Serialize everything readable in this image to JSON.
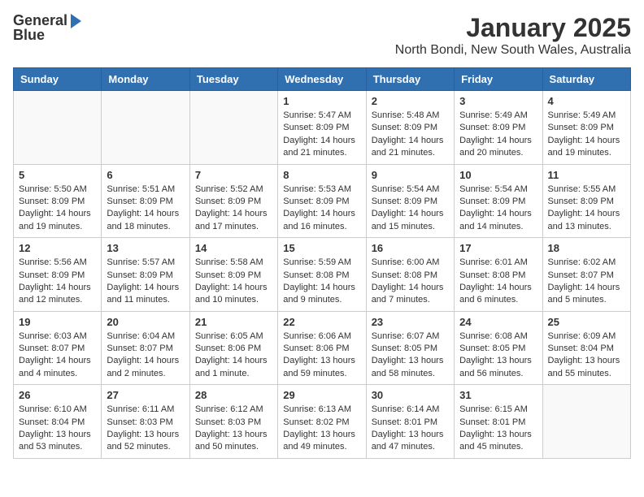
{
  "logo": {
    "line1": "General",
    "line2": "Blue"
  },
  "title": "January 2025",
  "subtitle": "North Bondi, New South Wales, Australia",
  "days_of_week": [
    "Sunday",
    "Monday",
    "Tuesday",
    "Wednesday",
    "Thursday",
    "Friday",
    "Saturday"
  ],
  "weeks": [
    [
      {
        "day": "",
        "info": ""
      },
      {
        "day": "",
        "info": ""
      },
      {
        "day": "",
        "info": ""
      },
      {
        "day": "1",
        "info": "Sunrise: 5:47 AM\nSunset: 8:09 PM\nDaylight: 14 hours\nand 21 minutes."
      },
      {
        "day": "2",
        "info": "Sunrise: 5:48 AM\nSunset: 8:09 PM\nDaylight: 14 hours\nand 21 minutes."
      },
      {
        "day": "3",
        "info": "Sunrise: 5:49 AM\nSunset: 8:09 PM\nDaylight: 14 hours\nand 20 minutes."
      },
      {
        "day": "4",
        "info": "Sunrise: 5:49 AM\nSunset: 8:09 PM\nDaylight: 14 hours\nand 19 minutes."
      }
    ],
    [
      {
        "day": "5",
        "info": "Sunrise: 5:50 AM\nSunset: 8:09 PM\nDaylight: 14 hours\nand 19 minutes."
      },
      {
        "day": "6",
        "info": "Sunrise: 5:51 AM\nSunset: 8:09 PM\nDaylight: 14 hours\nand 18 minutes."
      },
      {
        "day": "7",
        "info": "Sunrise: 5:52 AM\nSunset: 8:09 PM\nDaylight: 14 hours\nand 17 minutes."
      },
      {
        "day": "8",
        "info": "Sunrise: 5:53 AM\nSunset: 8:09 PM\nDaylight: 14 hours\nand 16 minutes."
      },
      {
        "day": "9",
        "info": "Sunrise: 5:54 AM\nSunset: 8:09 PM\nDaylight: 14 hours\nand 15 minutes."
      },
      {
        "day": "10",
        "info": "Sunrise: 5:54 AM\nSunset: 8:09 PM\nDaylight: 14 hours\nand 14 minutes."
      },
      {
        "day": "11",
        "info": "Sunrise: 5:55 AM\nSunset: 8:09 PM\nDaylight: 14 hours\nand 13 minutes."
      }
    ],
    [
      {
        "day": "12",
        "info": "Sunrise: 5:56 AM\nSunset: 8:09 PM\nDaylight: 14 hours\nand 12 minutes."
      },
      {
        "day": "13",
        "info": "Sunrise: 5:57 AM\nSunset: 8:09 PM\nDaylight: 14 hours\nand 11 minutes."
      },
      {
        "day": "14",
        "info": "Sunrise: 5:58 AM\nSunset: 8:09 PM\nDaylight: 14 hours\nand 10 minutes."
      },
      {
        "day": "15",
        "info": "Sunrise: 5:59 AM\nSunset: 8:08 PM\nDaylight: 14 hours\nand 9 minutes."
      },
      {
        "day": "16",
        "info": "Sunrise: 6:00 AM\nSunset: 8:08 PM\nDaylight: 14 hours\nand 7 minutes."
      },
      {
        "day": "17",
        "info": "Sunrise: 6:01 AM\nSunset: 8:08 PM\nDaylight: 14 hours\nand 6 minutes."
      },
      {
        "day": "18",
        "info": "Sunrise: 6:02 AM\nSunset: 8:07 PM\nDaylight: 14 hours\nand 5 minutes."
      }
    ],
    [
      {
        "day": "19",
        "info": "Sunrise: 6:03 AM\nSunset: 8:07 PM\nDaylight: 14 hours\nand 4 minutes."
      },
      {
        "day": "20",
        "info": "Sunrise: 6:04 AM\nSunset: 8:07 PM\nDaylight: 14 hours\nand 2 minutes."
      },
      {
        "day": "21",
        "info": "Sunrise: 6:05 AM\nSunset: 8:06 PM\nDaylight: 14 hours\nand 1 minute."
      },
      {
        "day": "22",
        "info": "Sunrise: 6:06 AM\nSunset: 8:06 PM\nDaylight: 13 hours\nand 59 minutes."
      },
      {
        "day": "23",
        "info": "Sunrise: 6:07 AM\nSunset: 8:05 PM\nDaylight: 13 hours\nand 58 minutes."
      },
      {
        "day": "24",
        "info": "Sunrise: 6:08 AM\nSunset: 8:05 PM\nDaylight: 13 hours\nand 56 minutes."
      },
      {
        "day": "25",
        "info": "Sunrise: 6:09 AM\nSunset: 8:04 PM\nDaylight: 13 hours\nand 55 minutes."
      }
    ],
    [
      {
        "day": "26",
        "info": "Sunrise: 6:10 AM\nSunset: 8:04 PM\nDaylight: 13 hours\nand 53 minutes."
      },
      {
        "day": "27",
        "info": "Sunrise: 6:11 AM\nSunset: 8:03 PM\nDaylight: 13 hours\nand 52 minutes."
      },
      {
        "day": "28",
        "info": "Sunrise: 6:12 AM\nSunset: 8:03 PM\nDaylight: 13 hours\nand 50 minutes."
      },
      {
        "day": "29",
        "info": "Sunrise: 6:13 AM\nSunset: 8:02 PM\nDaylight: 13 hours\nand 49 minutes."
      },
      {
        "day": "30",
        "info": "Sunrise: 6:14 AM\nSunset: 8:01 PM\nDaylight: 13 hours\nand 47 minutes."
      },
      {
        "day": "31",
        "info": "Sunrise: 6:15 AM\nSunset: 8:01 PM\nDaylight: 13 hours\nand 45 minutes."
      },
      {
        "day": "",
        "info": ""
      }
    ]
  ]
}
